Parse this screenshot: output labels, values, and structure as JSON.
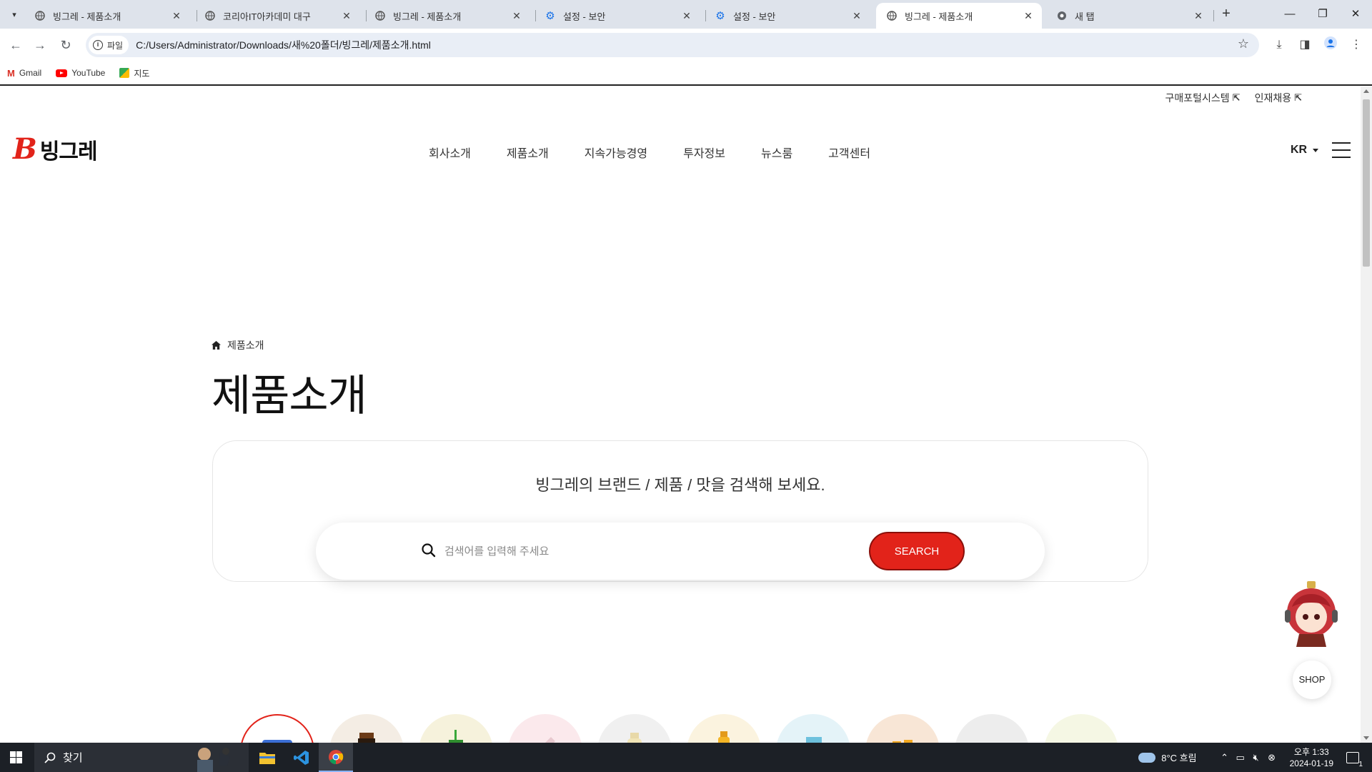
{
  "browser": {
    "tabs": [
      {
        "title": "빙그레 - 제품소개",
        "icon": "globe-icon",
        "active": false
      },
      {
        "title": "코리아IT아카데미 대구",
        "icon": "globe-icon",
        "active": false
      },
      {
        "title": "빙그레 - 제품소개",
        "icon": "globe-icon",
        "active": false
      },
      {
        "title": "설정 - 보안",
        "icon": "gear-icon",
        "active": false
      },
      {
        "title": "설정 - 보안",
        "icon": "gear-icon",
        "active": false
      },
      {
        "title": "빙그레 - 제품소개",
        "icon": "globe-icon",
        "active": true
      },
      {
        "title": "새 탭",
        "icon": "chrome-icon",
        "active": false
      }
    ],
    "address": {
      "scheme_chip": "파일",
      "url": "C:/Users/Administrator/Downloads/새%20폴더/빙그레/제품소개.html"
    },
    "bookmarks": [
      {
        "label": "Gmail",
        "icon": "gmail-icon"
      },
      {
        "label": "YouTube",
        "icon": "youtube-icon"
      },
      {
        "label": "지도",
        "icon": "maps-icon"
      }
    ]
  },
  "site": {
    "utility_links": [
      "구매포털시스템",
      "인재채용"
    ],
    "logo_text": "빙그레",
    "logo_mark": "B",
    "nav": [
      "회사소개",
      "제품소개",
      "지속가능경영",
      "투자정보",
      "뉴스룸",
      "고객센터"
    ],
    "lang": "KR",
    "breadcrumb": "제품소개",
    "page_title": "제품소개",
    "search": {
      "guide": "빙그레의 브랜드 / 제품 / 맛을 검색해 보세요.",
      "placeholder": "검색어를 입력해 주세요",
      "button": "SEARCH"
    },
    "shop_label": "SHOP",
    "accent_color": "#e2231a"
  },
  "taskbar": {
    "search_label": "찾기",
    "weather": "8°C  흐림",
    "time": "오후 1:33",
    "date": "2024-01-19",
    "notification_count": "1"
  }
}
